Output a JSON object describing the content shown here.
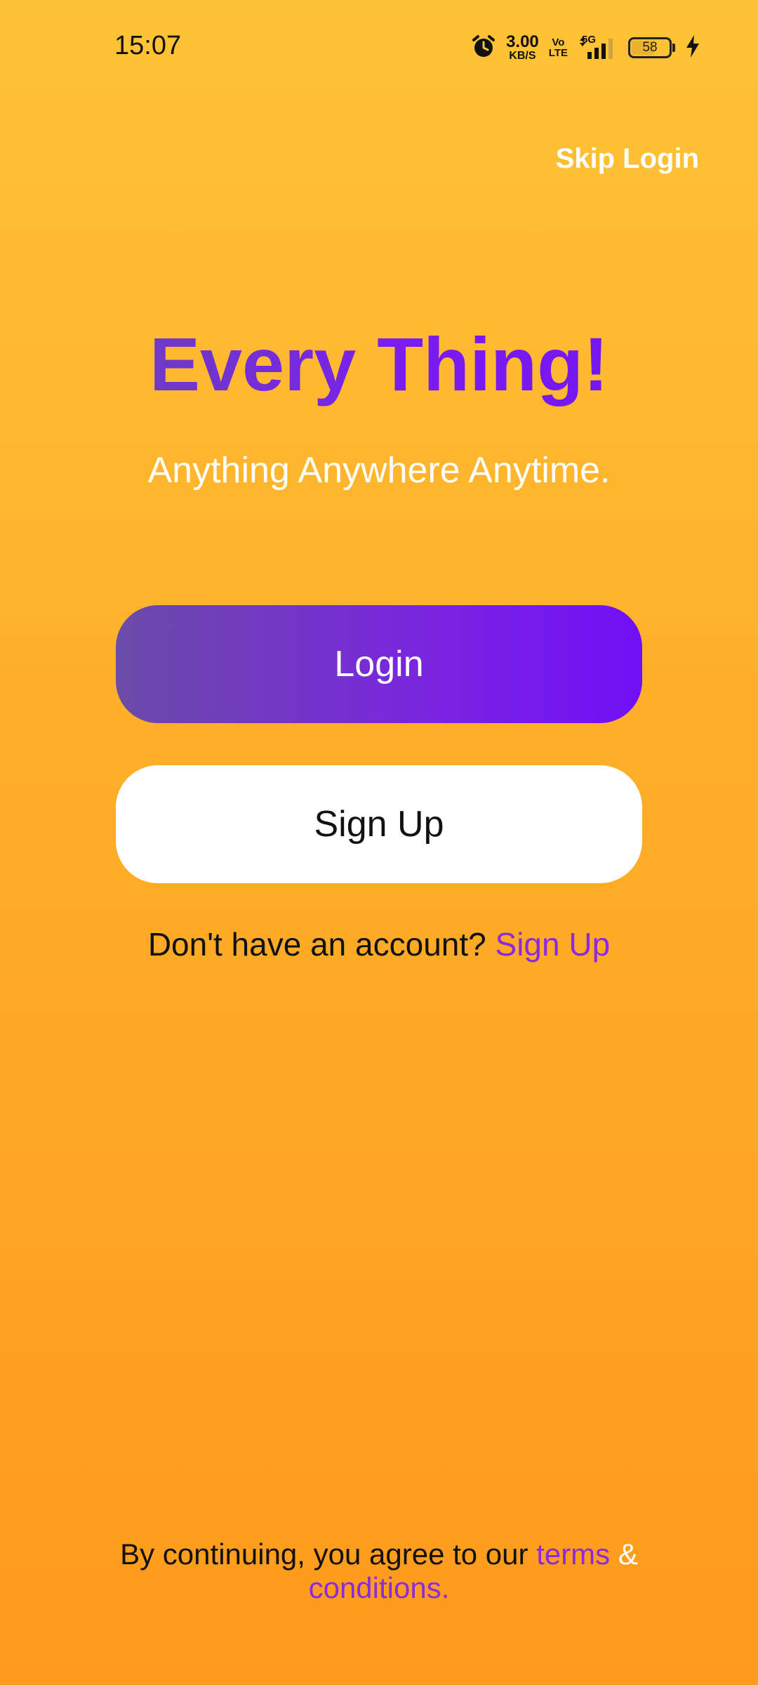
{
  "status_bar": {
    "time": "15:07",
    "net_speed_value": "3.00",
    "net_speed_unit": "KB/S",
    "volte_top": "Vo",
    "volte_bottom": "LTE",
    "network_type": "5G",
    "battery_level": "58",
    "icons": [
      "alarm-icon",
      "signal-icon",
      "battery-icon",
      "charging-icon"
    ]
  },
  "header": {
    "skip_label": "Skip Login"
  },
  "hero": {
    "title": "Every Thing!",
    "tagline": "Anything Anywhere Anytime."
  },
  "actions": {
    "login_label": "Login",
    "signup_label": "Sign Up"
  },
  "account_prompt": {
    "text": "Don't have an account? ",
    "link": "Sign Up"
  },
  "footer": {
    "text": "By continuing, you agree to our ",
    "terms_link": "terms",
    "ampersand": " &",
    "conditions_link": "conditions."
  },
  "colors": {
    "background_top": "#FFC336",
    "background_bottom": "#FF9A1A",
    "accent_purple": "#7012F5",
    "link_purple": "#8A2BE2",
    "white": "#FFFFFF"
  }
}
